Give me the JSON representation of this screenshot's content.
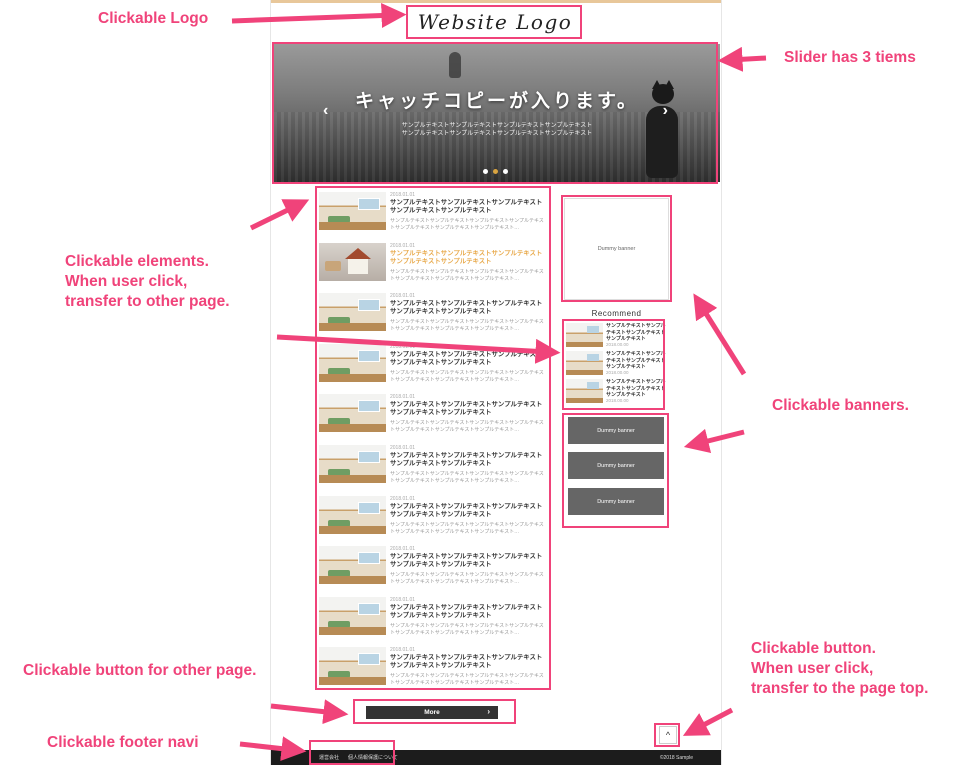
{
  "site": {
    "logo_text": "Website Logo",
    "slider": {
      "headline": "キャッチコピーが入ります。",
      "body_lines": [
        "サンプルテキストサンプルテキストサンプルテキストサンプルテキスト",
        "サンプルテキストサンプルテキストサンプルテキストサンプルテキスト"
      ],
      "prev_symbol": "‹",
      "next_symbol": "›",
      "slide_count": 3,
      "active_slide": 2
    },
    "articles": [
      {
        "date": "2018.01.01",
        "title": "サンプルテキストサンプルテキストサンプルテキストサンプルテキストサンプルテキスト",
        "excerpt": "サンプルテキストサンプルテキストサンプルテキストサンプルテキストサンプルテキストサンプルテキストサンプルテキスト…",
        "thumb": "room"
      },
      {
        "date": "2018.01.01",
        "title": "サンプルテキストサンプルテキストサンプルテキストサンプルテキストサンプルテキスト",
        "excerpt": "サンプルテキストサンプルテキストサンプルテキストサンプルテキストサンプルテキストサンプルテキストサンプルテキスト…",
        "thumb": "house",
        "hover": true
      },
      {
        "date": "2018.01.01",
        "title": "サンプルテキストサンプルテキストサンプルテキストサンプルテキストサンプルテキスト",
        "excerpt": "サンプルテキストサンプルテキストサンプルテキストサンプルテキストサンプルテキストサンプルテキストサンプルテキスト…",
        "thumb": "room"
      },
      {
        "date": "2018.01.01",
        "title": "サンプルテキストサンプルテキストサンプルテキストサンプルテキストサンプルテキスト",
        "excerpt": "サンプルテキストサンプルテキストサンプルテキストサンプルテキストサンプルテキストサンプルテキストサンプルテキスト…",
        "thumb": "room"
      },
      {
        "date": "2018.01.01",
        "title": "サンプルテキストサンプルテキストサンプルテキストサンプルテキストサンプルテキスト",
        "excerpt": "サンプルテキストサンプルテキストサンプルテキストサンプルテキストサンプルテキストサンプルテキストサンプルテキスト…",
        "thumb": "room"
      },
      {
        "date": "2018.01.01",
        "title": "サンプルテキストサンプルテキストサンプルテキストサンプルテキストサンプルテキスト",
        "excerpt": "サンプルテキストサンプルテキストサンプルテキストサンプルテキストサンプルテキストサンプルテキストサンプルテキスト…",
        "thumb": "room"
      },
      {
        "date": "2018.01.01",
        "title": "サンプルテキストサンプルテキストサンプルテキストサンプルテキストサンプルテキスト",
        "excerpt": "サンプルテキストサンプルテキストサンプルテキストサンプルテキストサンプルテキストサンプルテキストサンプルテキスト…",
        "thumb": "room"
      },
      {
        "date": "2018.01.01",
        "title": "サンプルテキストサンプルテキストサンプルテキストサンプルテキストサンプルテキスト",
        "excerpt": "サンプルテキストサンプルテキストサンプルテキストサンプルテキストサンプルテキストサンプルテキストサンプルテキスト…",
        "thumb": "room"
      },
      {
        "date": "2018.01.01",
        "title": "サンプルテキストサンプルテキストサンプルテキストサンプルテキストサンプルテキスト",
        "excerpt": "サンプルテキストサンプルテキストサンプルテキストサンプルテキストサンプルテキストサンプルテキストサンプルテキスト…",
        "thumb": "room"
      },
      {
        "date": "2018.01.01",
        "title": "サンプルテキストサンプルテキストサンプルテキストサンプルテキストサンプルテキスト",
        "excerpt": "サンプルテキストサンプルテキストサンプルテキストサンプルテキストサンプルテキストサンプルテキストサンプルテキスト…",
        "thumb": "room"
      }
    ],
    "sidebar": {
      "top_banner_label": "Dummy banner",
      "recommend_title": "Recommend",
      "recommend_items": [
        {
          "title": "サンプルテキストサンプルテキストサンプルテキストサンプルテキスト",
          "date": "2018.00.00"
        },
        {
          "title": "サンプルテキストサンプルテキストサンプルテキストサンプルテキスト",
          "date": "2018.00.00"
        },
        {
          "title": "サンプルテキストサンプルテキストサンプルテキストサンプルテキスト",
          "date": "2018.00.00"
        }
      ],
      "gray_banners": [
        "Dummy banner",
        "Dummy banner",
        "Dummy banner"
      ]
    },
    "more_button": {
      "label": "More",
      "chevron": "›"
    },
    "pagetop_button": {
      "symbol": "^"
    },
    "footer": {
      "nav": [
        "運営会社",
        "個人情報保護について"
      ],
      "copyright": "©2018 Sample"
    }
  },
  "annotations": {
    "logo": "Clickable Logo",
    "slider": "Slider has 3 tiems",
    "elements": [
      "Clickable elements.",
      "When  user click,",
      "transfer to other page."
    ],
    "banners": "Clickable banners.",
    "more": "Clickable button for other page.",
    "pagetop": [
      "Clickable button.",
      "When user click,",
      "transfer to the page top."
    ],
    "footer": "Clickable footer navi",
    "accent_color": "#f0437a"
  }
}
